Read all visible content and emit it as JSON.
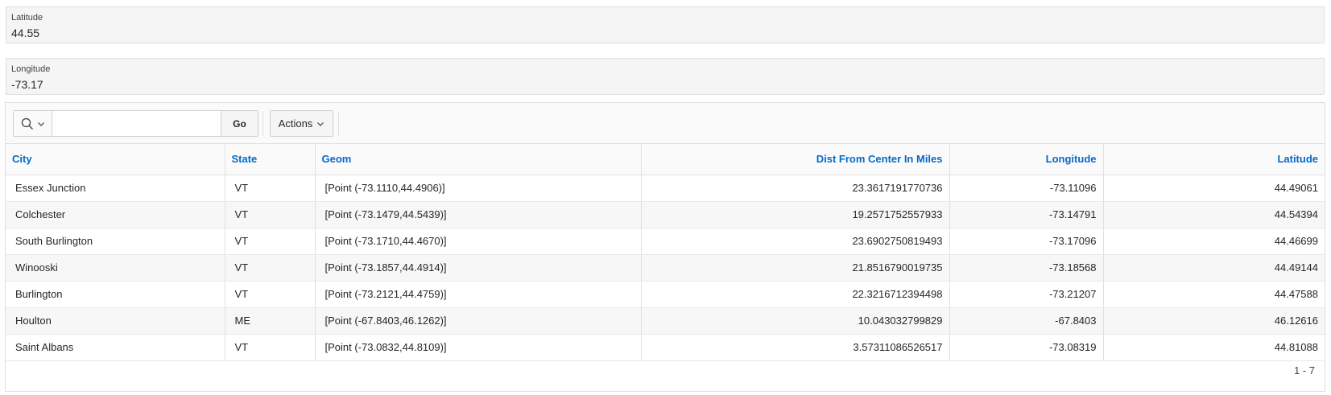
{
  "latitude_field": {
    "label": "Latitude",
    "value": "44.55"
  },
  "longitude_field": {
    "label": "Longitude",
    "value": "-73.17"
  },
  "toolbar": {
    "search_value": "",
    "go_label": "Go",
    "actions_label": "Actions"
  },
  "table": {
    "columns": [
      "City",
      "State",
      "Geom",
      "Dist From Center In Miles",
      "Longitude",
      "Latitude"
    ],
    "rows": [
      [
        "Essex Junction",
        "VT",
        "[Point (-73.1110,44.4906)]",
        "23.3617191770736",
        "-73.11096",
        "44.49061"
      ],
      [
        "Colchester",
        "VT",
        "[Point (-73.1479,44.5439)]",
        "19.2571752557933",
        "-73.14791",
        "44.54394"
      ],
      [
        "South Burlington",
        "VT",
        "[Point (-73.1710,44.4670)]",
        "23.6902750819493",
        "-73.17096",
        "44.46699"
      ],
      [
        "Winooski",
        "VT",
        "[Point (-73.1857,44.4914)]",
        "21.8516790019735",
        "-73.18568",
        "44.49144"
      ],
      [
        "Burlington",
        "VT",
        "[Point (-73.2121,44.4759)]",
        "22.3216712394498",
        "-73.21207",
        "44.47588"
      ],
      [
        "Houlton",
        "ME",
        "[Point (-67.8403,46.1262)]",
        "10.043032799829",
        "-67.8403",
        "46.12616"
      ],
      [
        "Saint Albans",
        "VT",
        "[Point (-73.0832,44.8109)]",
        "3.57311086526517",
        "-73.08319",
        "44.81088"
      ]
    ]
  },
  "pagination": {
    "text": "1 - 7"
  },
  "colors": {
    "link": "#056ac8",
    "border": "#e0e0e0"
  }
}
